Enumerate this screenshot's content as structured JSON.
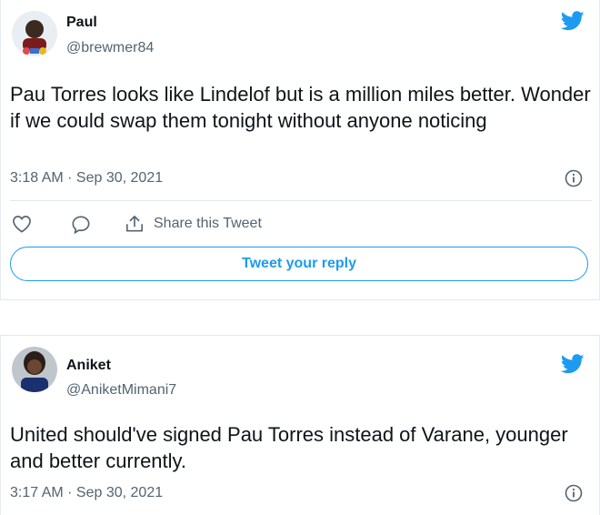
{
  "tweets": [
    {
      "name": "Paul",
      "handle": "@brewmer84",
      "text": "Pau Torres looks like Lindelof but is a million miles better. Wonder if we could swap them tonight without anyone noticing",
      "timestamp": "3:18 AM · Sep 30, 2021",
      "actions": {
        "share_label": "Share this Tweet",
        "reply_label": "Tweet your reply"
      }
    },
    {
      "name": "Aniket",
      "handle": "@AniketMimani7",
      "text": "United should've signed Pau Torres instead of Varane, younger and better currently.",
      "timestamp": "3:17 AM · Sep 30, 2021"
    }
  ],
  "colors": {
    "accent": "#1d9bf0",
    "muted": "#536471",
    "border": "#e1e8ed"
  },
  "icons": [
    "twitter-bird-icon",
    "info-icon",
    "heart-icon",
    "comment-icon",
    "share-icon"
  ]
}
